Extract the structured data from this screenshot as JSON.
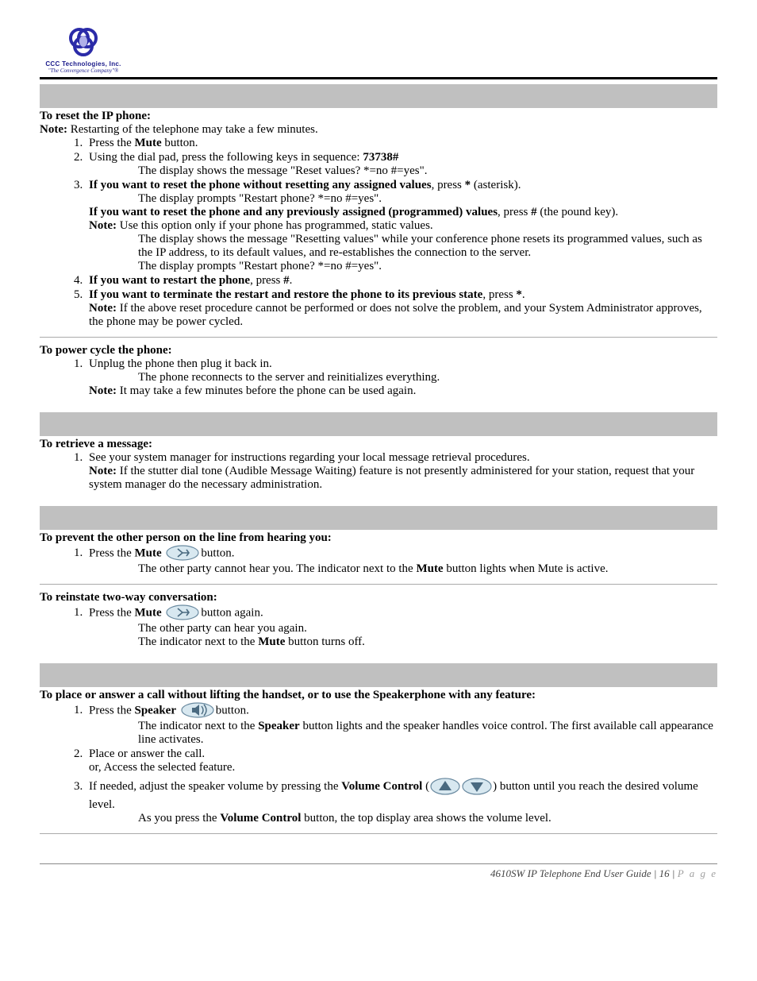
{
  "logo": {
    "line1": "CCC Technologies, Inc.",
    "line2": "\"The Convergence Company\"®"
  },
  "reset": {
    "title": "To reset the IP phone:",
    "note_label": "Note:",
    "note": " Restarting of the telephone may take a few minutes.",
    "s1_pre": "Press the ",
    "s1_bold": "Mute",
    "s1_post": " button.",
    "s2_pre": "Using the dial pad, press the following keys in sequence: ",
    "s2_bold": "73738#",
    "s2_sub": "The display shows the message \"Reset values? *=no #=yes\".",
    "s3_bold": "If you want to reset the phone without resetting any assigned values",
    "s3_mid": ", press ",
    "s3_star": "*",
    "s3_post": " (asterisk).",
    "s3_sub": "The display prompts \"Restart phone? *=no #=yes\".",
    "s3b_bold": "If you want to reset the phone and any previously assigned (programmed) values",
    "s3b_mid": ", press ",
    "s3b_hash": "#",
    "s3b_post": " (the pound key).",
    "s3b_note_label": "Note:",
    "s3b_note": " Use this option only if your phone has programmed, static values.",
    "s3b_sub1": "The display shows the message \"Resetting values\" while your conference phone resets its programmed values, such as the IP address, to its default values, and re-establishes the connection to the server.",
    "s3b_sub2": "The display prompts \"Restart phone? *=no #=yes\".",
    "s4_bold": "If you want to restart the phone",
    "s4_mid": ", press ",
    "s4_hash": "#",
    "s4_post": ".",
    "s5_bold": "If you want to terminate the restart and restore the phone to its previous state",
    "s5_mid": ", press ",
    "s5_star": "*",
    "s5_post": ".",
    "s5_note_label": "Note:",
    "s5_note": " If the above reset procedure cannot be performed or does not solve the problem, and your System Administrator approves, the phone may be power cycled."
  },
  "power": {
    "title": "To power cycle the phone:",
    "s1": "Unplug the phone then plug it back in.",
    "s1_sub": "The phone reconnects to the server and reinitializes everything.",
    "s1_note_label": "Note:",
    "s1_note": " It may take a few minutes before the phone can be used again."
  },
  "retrieve": {
    "title": "To retrieve a message:",
    "s1": "See your system manager for instructions regarding your local message retrieval procedures.",
    "s1_note_label": "Note:",
    "s1_note": " If the stutter dial tone (Audible Message Waiting) feature is not presently administered for your station, request that your system manager do the necessary administration."
  },
  "mute_on": {
    "title": "To prevent the other person on the line from hearing you:",
    "s1_pre": "Press the ",
    "s1_bold": "Mute",
    "s1_post": "button.",
    "s1_sub_a": "The other party cannot hear you. The indicator next to the ",
    "s1_sub_b": "Mute",
    "s1_sub_c": " button lights when Mute is active."
  },
  "mute_off": {
    "title": "To reinstate two-way conversation:",
    "s1_pre": "Press the ",
    "s1_bold": "Mute",
    "s1_post": "button again.",
    "s1_sub1": "The other party can hear you again.",
    "s1_sub2_a": "The indicator next to the ",
    "s1_sub2_b": "Mute",
    "s1_sub2_c": " button turns off."
  },
  "speaker": {
    "title": "To place or answer a call without lifting the handset, or to use the Speakerphone with any feature:",
    "s1_pre": "Press the ",
    "s1_bold": "Speaker",
    "s1_post": "button.",
    "s1_sub_a": "The indicator next to the ",
    "s1_sub_b": "Speaker",
    "s1_sub_c": " button lights and the speaker handles voice control. The first available call appearance line activates.",
    "s2a": "Place or answer the call.",
    "s2b": "or, Access the selected feature.",
    "s3_pre": "If needed, adjust the speaker volume by pressing the ",
    "s3_bold": "Volume Control",
    "s3_paren_open": " (",
    "s3_paren_close": ") button until you reach the desired volume level.",
    "s3_sub_a": "As you press the ",
    "s3_sub_b": "Volume Control",
    "s3_sub_c": " button, the top display area shows the volume level."
  },
  "footer": {
    "doc": "4610SW IP Telephone End User Guide | 16 | ",
    "page_word": "P a g e"
  }
}
